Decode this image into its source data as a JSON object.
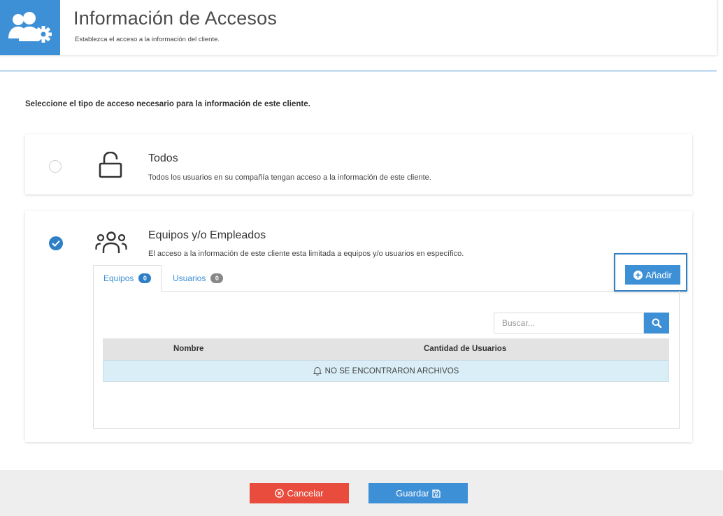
{
  "header": {
    "title": "Información de Accesos",
    "subtitle": "Establezca el acceso a la información del cliente.",
    "icon": "users-gear-icon",
    "accent_color": "#3d8fd6"
  },
  "instruction": "Seleccione el tipo de acceso necesario para la información de este cliente.",
  "options": {
    "todos": {
      "title": "Todos",
      "description": "Todos los usuarios en su compañía tengan acceso a la información de este cliente.",
      "selected": false,
      "icon": "unlock-icon"
    },
    "equipos": {
      "title": "Equipos y/o Empleados",
      "description": "El acceso a la información de este cliente esta limitada a equipos y/o usuarios en específico.",
      "selected": true,
      "icon": "users-icon"
    }
  },
  "tabs": [
    {
      "label": "Equipos",
      "count": "0",
      "active": true
    },
    {
      "label": "Usuarios",
      "count": "0",
      "active": false
    }
  ],
  "add_button": {
    "label": "Añadir",
    "icon": "plus-circle-icon"
  },
  "search": {
    "placeholder": "Buscar...",
    "value": "",
    "icon": "search-icon"
  },
  "table": {
    "columns": [
      "Nombre",
      "Cantidad de Usuarios"
    ],
    "empty_message": "NO SE ENCONTRARON ARCHIVOS",
    "empty_icon": "bell-icon"
  },
  "footer": {
    "cancel_label": "Cancelar",
    "cancel_icon": "times-circle-icon",
    "cancel_color": "#e94b3c",
    "save_label": "Guardar",
    "save_icon": "floppy-disk-icon",
    "save_color": "#3d8fd6"
  }
}
